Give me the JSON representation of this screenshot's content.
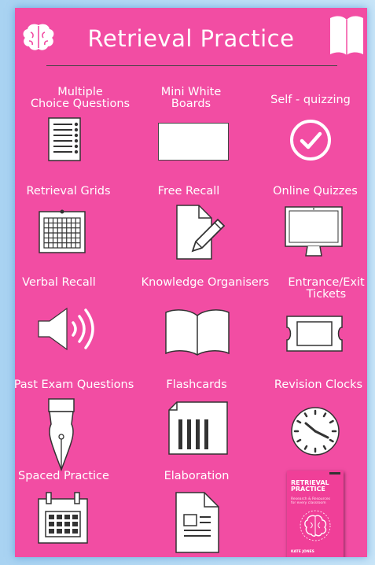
{
  "title": "Retrieval Practice",
  "cells": [
    {
      "label": "Multiple\nChoice Questions",
      "icon": "mcq-list-icon"
    },
    {
      "label": "Mini White\nBoards",
      "icon": "whiteboard-icon"
    },
    {
      "label": "Self - quizzing",
      "icon": "checkmark-circle-icon"
    },
    {
      "label": "Retrieval Grids",
      "icon": "grid-icon"
    },
    {
      "label": "Free Recall",
      "icon": "paper-pencil-icon"
    },
    {
      "label": "Online Quizzes",
      "icon": "monitor-icon"
    },
    {
      "label": "Verbal Recall",
      "icon": "speaker-icon"
    },
    {
      "label": "Knowledge Organisers",
      "icon": "open-book-icon"
    },
    {
      "label": "Entrance/Exit\nTickets",
      "icon": "ticket-icon"
    },
    {
      "label": "Past Exam Questions",
      "icon": "fountain-pen-icon"
    },
    {
      "label": "Flashcards",
      "icon": "flashcards-icon"
    },
    {
      "label": "Revision Clocks",
      "icon": "clock-icon"
    },
    {
      "label": "Spaced Practice",
      "icon": "calendar-icon"
    },
    {
      "label": "Elaboration",
      "icon": "document-icon"
    }
  ],
  "book": {
    "title": "RETRIEVAL\nPRACTICE",
    "subtitle": "Research & Resources\nfor every classroom",
    "author": "KATE JONES"
  }
}
